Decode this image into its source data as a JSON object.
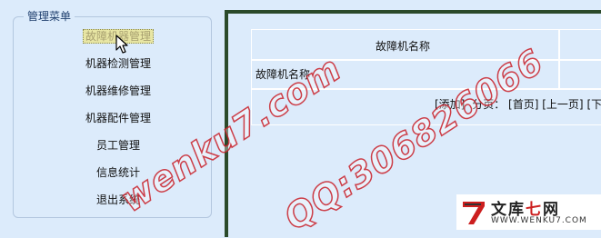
{
  "menu": {
    "legend": "管理菜单",
    "items": [
      {
        "label": "故障机器管理",
        "selected": true
      },
      {
        "label": "机器检测管理"
      },
      {
        "label": "机器维修管理"
      },
      {
        "label": "机器配件管理"
      },
      {
        "label": "员工管理"
      },
      {
        "label": "信息统计"
      },
      {
        "label": "退出系统"
      }
    ]
  },
  "main": {
    "header_col": "故障机名称",
    "row_label": "故障机名称",
    "pager": {
      "add": "[添加]",
      "page_label": "分页：",
      "first": "[首页]",
      "prev": "[上一页]",
      "next": "[下一"
    }
  },
  "watermark": {
    "site": "wenku7.com",
    "qq": "QQ:306826066"
  },
  "logo": {
    "text_black": "文库",
    "text_red": "七",
    "text_black2": "网",
    "url": "WWW.WENKU7.COM"
  },
  "colors": {
    "background": "#dcebfb",
    "frame_border": "#2b4a2a",
    "watermark_stroke": "#c81e28",
    "logo_red": "#cc1f1f"
  }
}
